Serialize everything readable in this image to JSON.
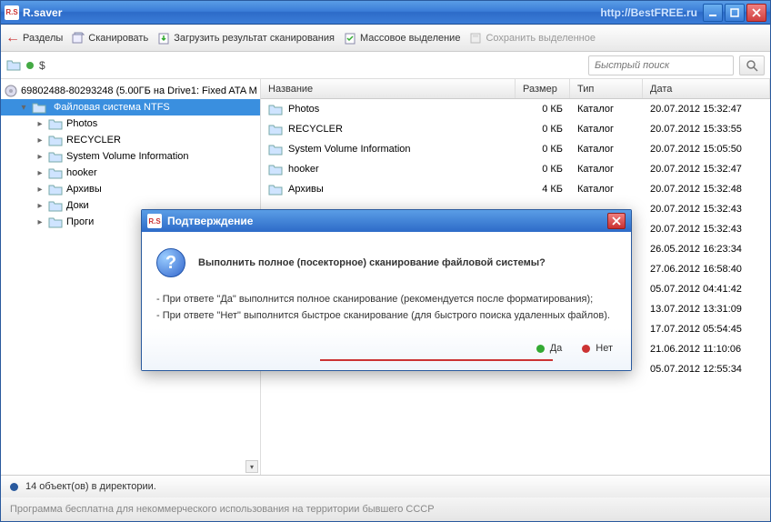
{
  "titlebar": {
    "app_icon_text": "R.S",
    "title": "R.saver",
    "url": "http://BestFREE.ru"
  },
  "toolbar": {
    "items": [
      {
        "icon": "arrow-back",
        "label": "Разделы"
      },
      {
        "icon": "scan",
        "label": "Сканировать"
      },
      {
        "icon": "load",
        "label": "Загрузить результат сканирования"
      },
      {
        "icon": "select",
        "label": "Массовое выделение"
      },
      {
        "icon": "save",
        "label": "Сохранить выделенное"
      }
    ]
  },
  "pathbar": {
    "path": "$",
    "search_placeholder": "Быстрый поиск"
  },
  "tree": {
    "root_label": "69802488-80293248 (5.00ГБ на Drive1: Fixed ATA M",
    "selected": "Файловая система NTFS",
    "children": [
      "Photos",
      "RECYCLER",
      "System Volume Information",
      "hooker",
      "Архивы",
      "Доки",
      "Проги"
    ]
  },
  "listview": {
    "columns": {
      "name": "Название",
      "size": "Размер",
      "type": "Тип",
      "date": "Дата"
    },
    "rows": [
      {
        "name": "Photos",
        "size": "0 КБ",
        "type": "Каталог",
        "date": "20.07.2012 15:32:47"
      },
      {
        "name": "RECYCLER",
        "size": "0 КБ",
        "type": "Каталог",
        "date": "20.07.2012 15:33:55"
      },
      {
        "name": "System Volume Information",
        "size": "0 КБ",
        "type": "Каталог",
        "date": "20.07.2012 15:05:50"
      },
      {
        "name": "hooker",
        "size": "0 КБ",
        "type": "Каталог",
        "date": "20.07.2012 15:32:47"
      },
      {
        "name": "Архивы",
        "size": "4 КБ",
        "type": "Каталог",
        "date": "20.07.2012 15:32:48"
      },
      {
        "name": "",
        "size": "",
        "type": "",
        "date": "20.07.2012 15:32:43"
      },
      {
        "name": "",
        "size": "",
        "type": "",
        "date": "20.07.2012 15:32:43"
      },
      {
        "name": "",
        "size": "",
        "type": "",
        "date": "26.05.2012 16:23:34"
      },
      {
        "name": "",
        "size": "",
        "type": "",
        "date": "27.06.2012 16:58:40"
      },
      {
        "name": "",
        "size": "",
        "type": "",
        "date": "05.07.2012 04:41:42"
      },
      {
        "name": "",
        "size": "",
        "type": "",
        "date": "13.07.2012 13:31:09"
      },
      {
        "name": "",
        "size": "",
        "type": "",
        "date": "17.07.2012 05:54:45"
      },
      {
        "name": "",
        "size": "",
        "type": "",
        "date": "21.06.2012 11:10:06"
      },
      {
        "name": "",
        "size": "",
        "type": "",
        "date": "05.07.2012 12:55:34"
      }
    ]
  },
  "statusbar": {
    "text": "14 объект(ов) в директории."
  },
  "footer": {
    "text": "Программа бесплатна для некоммерческого использования на территории бывшего СССР"
  },
  "dialog": {
    "icon_text": "R.S",
    "title": "Подтверждение",
    "question": "Выполнить полное (посекторное) сканирование файловой системы?",
    "lines": [
      "- При ответе \"Да\" выполнится полное сканирование (рекомендуется после форматирования);",
      "- При ответе \"Нет\" выполнится быстрое сканирование (для быстрого поиска удаленных файлов)."
    ],
    "yes": "Да",
    "no": "Нет"
  }
}
